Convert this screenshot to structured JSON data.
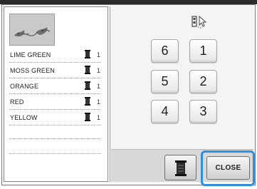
{
  "thread_colors": [
    {
      "name": "LIME GREEN",
      "count": "1"
    },
    {
      "name": "MOSS GREEN",
      "count": "1"
    },
    {
      "name": "ORANGE",
      "count": "1"
    },
    {
      "name": "RED",
      "count": "1"
    },
    {
      "name": "YELLOW",
      "count": "1"
    }
  ],
  "sequence_buttons": [
    "6",
    "1",
    "5",
    "2",
    "4",
    "3"
  ],
  "close_label": "CLOSE",
  "colors": {
    "highlight": "#2f8fe0",
    "thumbnail_bg": "#c9c9c9",
    "bottom_bar": "#d8d8d8"
  },
  "icons": {
    "thread_spool": "spool-icon",
    "stitch_selection": "stitch-pointer-icon",
    "thread_button": "thread-spool-icon"
  }
}
